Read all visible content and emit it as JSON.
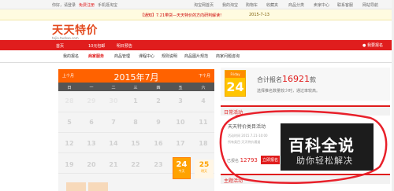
{
  "topbar": {
    "welcome": "你好，请登录",
    "register": "免费注册",
    "links": [
      "手机逛淘宝"
    ],
    "right_links": [
      "淘宝网首页",
      "我的淘宝",
      "购物车",
      "收藏夹",
      "商品分类",
      "卖家中心",
      "联系客服",
      "网站导航"
    ]
  },
  "notice": {
    "text": "【通知】7.21带货—天天特价的方向研判解读!",
    "date": "2015-7-13"
  },
  "logo": {
    "title": "天天特价",
    "subtitle": "tejia.taobao.com"
  },
  "main_nav": {
    "items": [
      "首页",
      "10元包邮",
      "明日预告"
    ],
    "right": "我要报名"
  },
  "sub_nav": {
    "items": [
      "我的报名",
      "商家服务",
      "商品管理",
      "课程中心",
      "规则说明",
      "商品图片规范",
      "商家问题咨询"
    ]
  },
  "calendar": {
    "prev": "上个月",
    "next": "下个月",
    "title": "2015年7月",
    "weekdays": [
      "日",
      "一",
      "二",
      "三",
      "四",
      "五",
      "六"
    ],
    "rows": [
      [
        "28",
        "29",
        "30",
        "1",
        "2",
        "3",
        "4"
      ],
      [
        "5",
        "6",
        "7",
        "8",
        "9",
        "10",
        "11"
      ],
      [
        "12",
        "13",
        "14",
        "15",
        "16",
        "17",
        "18"
      ],
      [
        "19",
        "20",
        "21",
        "22",
        "23",
        "24",
        "25"
      ]
    ],
    "today": {
      "day": "24",
      "label": "今天"
    },
    "next_day": {
      "day": "25",
      "label": "明天"
    }
  },
  "stats": {
    "weekday": "Friday",
    "day": "24",
    "label": "合计报名",
    "count": "16921",
    "unit": "款",
    "sub": "选择推名数量较少时，通过率较高。"
  },
  "sections": {
    "daily": "日常活动",
    "theme": "主题活动"
  },
  "activity": {
    "title": "天天特价类目活动",
    "line1": "活动时间 2015.7.21-10:00",
    "line2": "所有类目 天天特价通道",
    "count_label": "已报名",
    "count": "12793",
    "join": "立即报名"
  },
  "watermark": {
    "main": "百科全说",
    "sub": "助你轻松解决"
  },
  "colors": {
    "brand_red": "#e01d1d",
    "calendar_orange": "#ff6200",
    "today_orange": "#ffa200"
  }
}
